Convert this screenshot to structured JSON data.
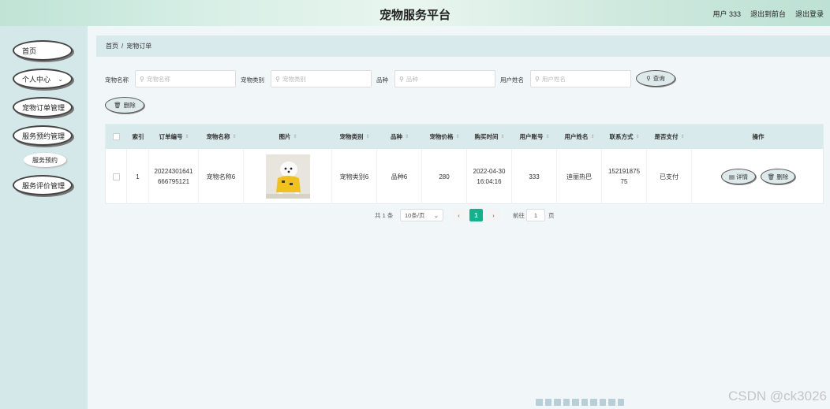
{
  "header": {
    "title": "宠物服务平台",
    "user_label": "用户 333",
    "back_label": "退出到前台",
    "logout_label": "退出登录"
  },
  "sidebar": {
    "items": [
      {
        "label": "首页"
      },
      {
        "label": "个人中心"
      },
      {
        "label": "宠物订单管理"
      },
      {
        "label": "服务预约管理"
      },
      {
        "label": "服务评价管理"
      }
    ],
    "submenu_label": "服务预约"
  },
  "breadcrumb": {
    "home": "首页",
    "sep": "/",
    "current": "宠物订单"
  },
  "filters": {
    "pet_name_label": "宠物名称",
    "pet_name_placeholder": "宠物名称",
    "pet_type_label": "宠物类别",
    "pet_type_placeholder": "宠物类别",
    "breed_label": "品种",
    "breed_placeholder": "品种",
    "user_name_label": "用户姓名",
    "user_name_placeholder": "用户姓名",
    "search_label": "查询",
    "delete_label": "删除"
  },
  "table": {
    "columns": [
      "索引",
      "订单编号",
      "宠物名称",
      "图片",
      "宠物类别",
      "品种",
      "宠物价格",
      "购买时间",
      "用户账号",
      "用户姓名",
      "联系方式",
      "是否支付",
      "操作"
    ],
    "rows": [
      {
        "index": "1",
        "order_no_1": "20224301641",
        "order_no_2": "666795121",
        "pet_name": "宠物名称6",
        "pet_type": "宠物类别6",
        "breed": "品种6",
        "price": "280",
        "time_1": "2022-04-30",
        "time_2": "16:04:16",
        "account": "333",
        "user_name": "迪丽热巴",
        "phone_1": "152191875",
        "phone_2": "75",
        "paid": "已支付",
        "detail_label": "详情",
        "delete_label": "删除"
      }
    ]
  },
  "pager": {
    "total": "共 1 条",
    "page_size": "10条/页",
    "current_page": "1",
    "goto_label": "前往",
    "goto_value": "1",
    "page_unit": "页"
  },
  "watermark": "CSDN @ck3026"
}
